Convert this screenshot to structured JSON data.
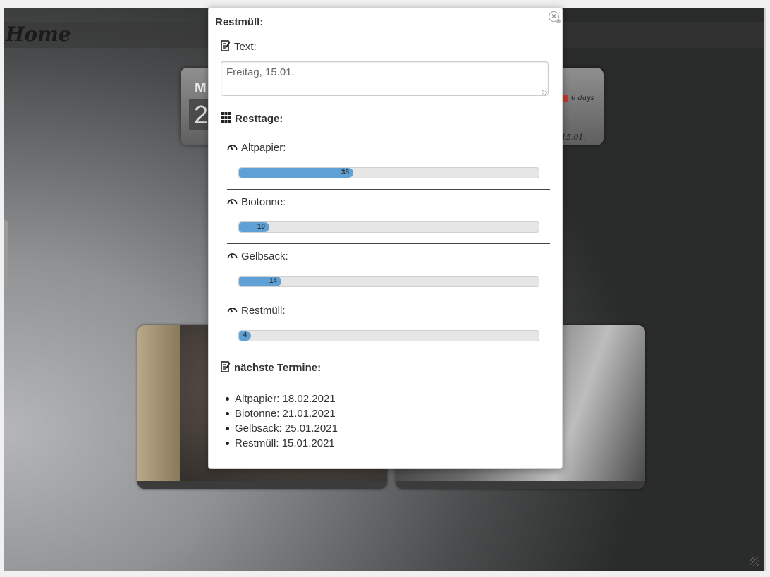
{
  "background": {
    "page_title": "Home",
    "clock_tile": {
      "letter": "M",
      "number": "2",
      "days_label": "6 days",
      "date_label": "15.01."
    }
  },
  "popup": {
    "title": "Restmüll:",
    "text_section": {
      "label": "Text:",
      "value": "Freitag, 15.01."
    },
    "resttage_section": {
      "label": "Resttage:",
      "max": 100,
      "items": [
        {
          "label": "Altpapier:",
          "value": 38
        },
        {
          "label": "Biotonne:",
          "value": 10
        },
        {
          "label": "Gelbsack:",
          "value": 14
        },
        {
          "label": "Restmüll:",
          "value": 4
        }
      ]
    },
    "termine_section": {
      "label": "nächste Termine:",
      "entries": [
        "Altpapier: 18.02.2021",
        "Biotonne: 21.01.2021",
        "Gelbsack: 25.01.2021",
        "Restmüll: 15.01.2021"
      ]
    }
  },
  "colors": {
    "bar_fill": "#5fa0d6",
    "bar_track": "#e6e6e6"
  },
  "icons": {
    "text": "note-edit-icon",
    "resttage": "grid-icon",
    "gauge": "gauge-icon",
    "termine": "note-edit-icon",
    "close": "close-settings-icon"
  }
}
